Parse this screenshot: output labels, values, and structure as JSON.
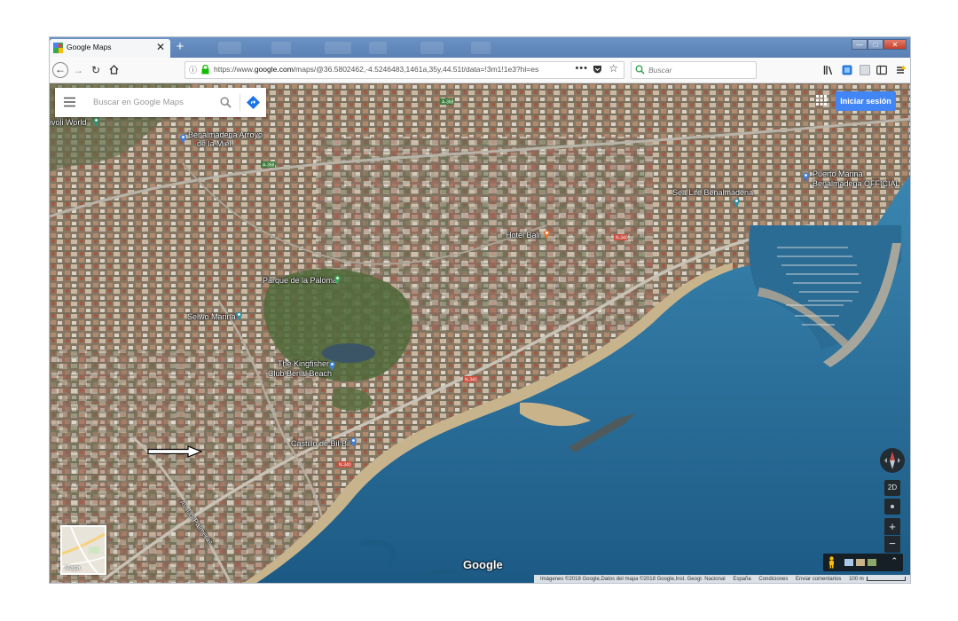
{
  "browser": {
    "tab_title": "Google Maps",
    "tab_close_glyph": "✕",
    "new_tab_glyph": "+",
    "url_prefix": "https://www.",
    "url_domain": "google.com",
    "url_path": "/maps/@36.5802462,-4.5246483,1461a,35y,44.51t/data=!3m1!1e3?hl=es",
    "search_placeholder": "Buscar",
    "page_actions_glyph": "•••",
    "icons": [
      "back-icon",
      "forward-icon",
      "reload-icon",
      "home-icon",
      "info-icon",
      "lock-icon",
      "pocket-icon",
      "star-icon",
      "library-icon",
      "extension-icon",
      "sidebar-icon",
      "menu-icon"
    ]
  },
  "maps": {
    "search_placeholder": "Buscar en Google Maps",
    "signin_label": "Iniciar sesión",
    "google_logo": "Google",
    "view_2d_label": "2D",
    "zoom_in_glyph": "+",
    "zoom_out_glyph": "−",
    "expand_glyph": "⌃",
    "minimap_label": "Mapa",
    "labels": {
      "tivoli": "ivoli World",
      "arroyo_1": "Benalmádena Arroyo",
      "arroyo_2": "de la Miel",
      "puerto_1": "Puerto Marina",
      "puerto_2": "Benalmádena OFFICIAL",
      "sealife": "Sea Life Benalmádena",
      "hotel_bali": "Hotel Bali",
      "parque": "Parque de la Paloma",
      "selwo": "Selwo Marina",
      "kingfisher_1": "The Kingfisher",
      "kingfisher_2": "Club Benal Beach",
      "castillo": "Castillo de Bil Bil",
      "av_palmeras": "Av. las Palmeras"
    },
    "road_labels": [
      "A-368",
      "A-368",
      "N-340",
      "N-340",
      "N-340"
    ],
    "footer": {
      "imagery": "Imágenes ©2018 Google,Datos del mapa ©2018 Google,Inst. Geogr. Nacional",
      "country": "España",
      "terms": "Condiciones",
      "feedback": "Enviar comentarios",
      "scale": "100 m"
    },
    "colors": {
      "sea": "#2d6f9a",
      "land": "#7b6f5a",
      "beach": "#c8b48c",
      "accent": "#4285f4"
    }
  }
}
